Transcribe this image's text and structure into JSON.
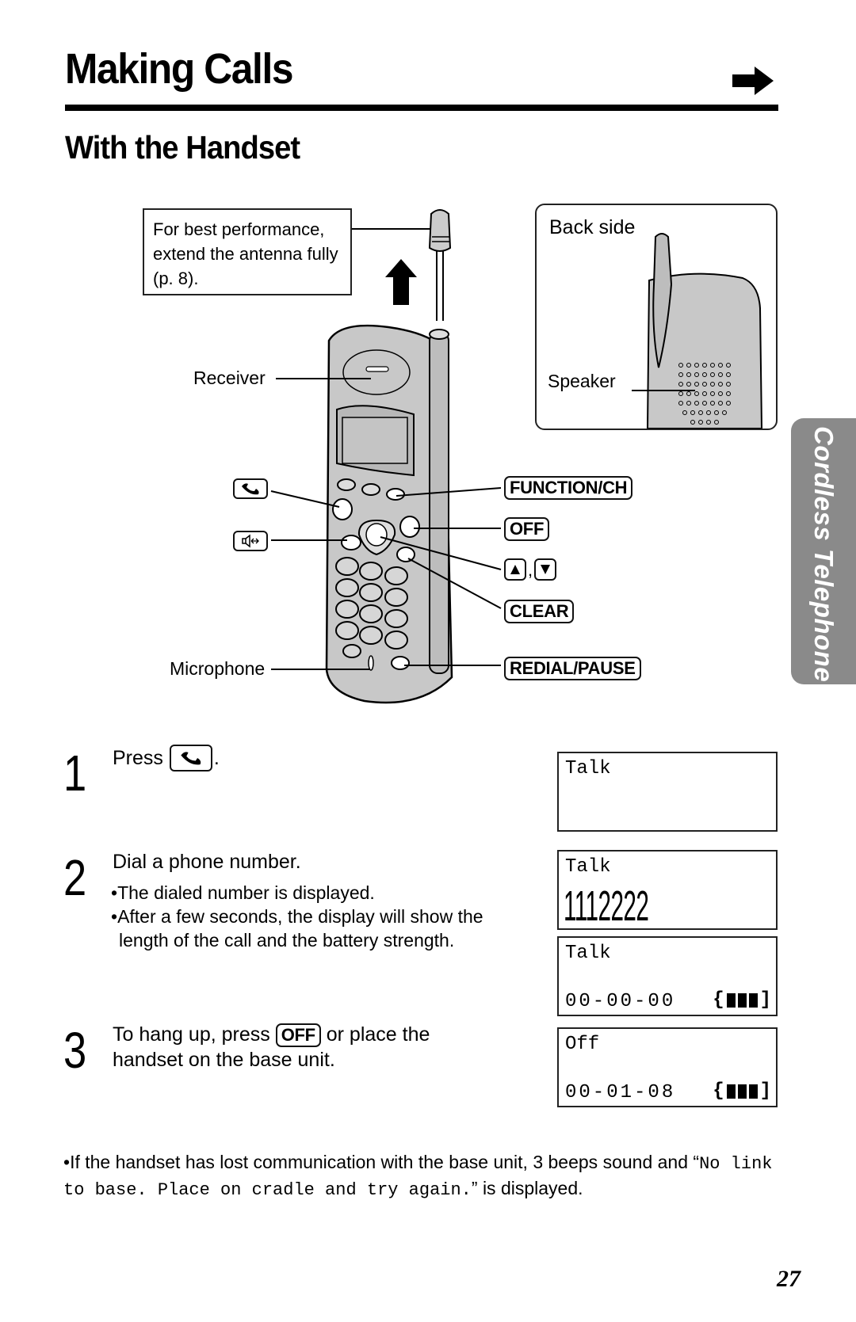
{
  "header": {
    "title": "Making Calls",
    "continue_icon": "right-arrow-icon",
    "subtitle": "With the Handset"
  },
  "side_tab": {
    "label": "Cordless Telephone",
    "color": "#8a8a8a"
  },
  "diagram": {
    "callout": "For best performance, extend the antenna fully (p. 8).",
    "back_side": {
      "title": "Back side",
      "speaker_label": "Speaker"
    },
    "left_labels": {
      "receiver": "Receiver",
      "microphone": "Microphone",
      "talk_key_icon": "phone-handset-icon",
      "speaker_key_icon": "speakerphone-icon"
    },
    "right_labels": {
      "function_ch": "FUNCTION/CH",
      "off": "OFF",
      "up_key_icon": "up-triangle-icon",
      "down_key_icon": "down-triangle-icon",
      "separator": ",",
      "clear": "CLEAR",
      "redial_pause": "REDIAL/PAUSE"
    }
  },
  "steps": [
    {
      "number": "1",
      "text_before": "Press",
      "key_icon": "phone-handset-icon",
      "text_after": "."
    },
    {
      "number": "2",
      "text": "Dial a phone number.",
      "bullets": [
        "The dialed number is displayed.",
        "After a few seconds, the display will show the length of the call and the battery strength."
      ]
    },
    {
      "number": "3",
      "text_before": "To hang up, press",
      "key": "OFF",
      "text_after": "or place the handset on the base unit."
    }
  ],
  "displays": [
    {
      "line1": "Talk",
      "line2": "",
      "battery": null
    },
    {
      "line1": "Talk",
      "number": "1112222",
      "battery": null
    },
    {
      "line1": "Talk",
      "line2": "00-00-00",
      "battery_bars": 3
    },
    {
      "line1": "Off",
      "line2": "00-01-08",
      "battery_bars": 3
    }
  ],
  "note": {
    "bullet_text": "If the handset has lost communication with the base unit, 3 beeps sound and “",
    "display_message": "No link to base. Place on cradle and try again.",
    "after": "” is displayed."
  },
  "page_number": "27"
}
